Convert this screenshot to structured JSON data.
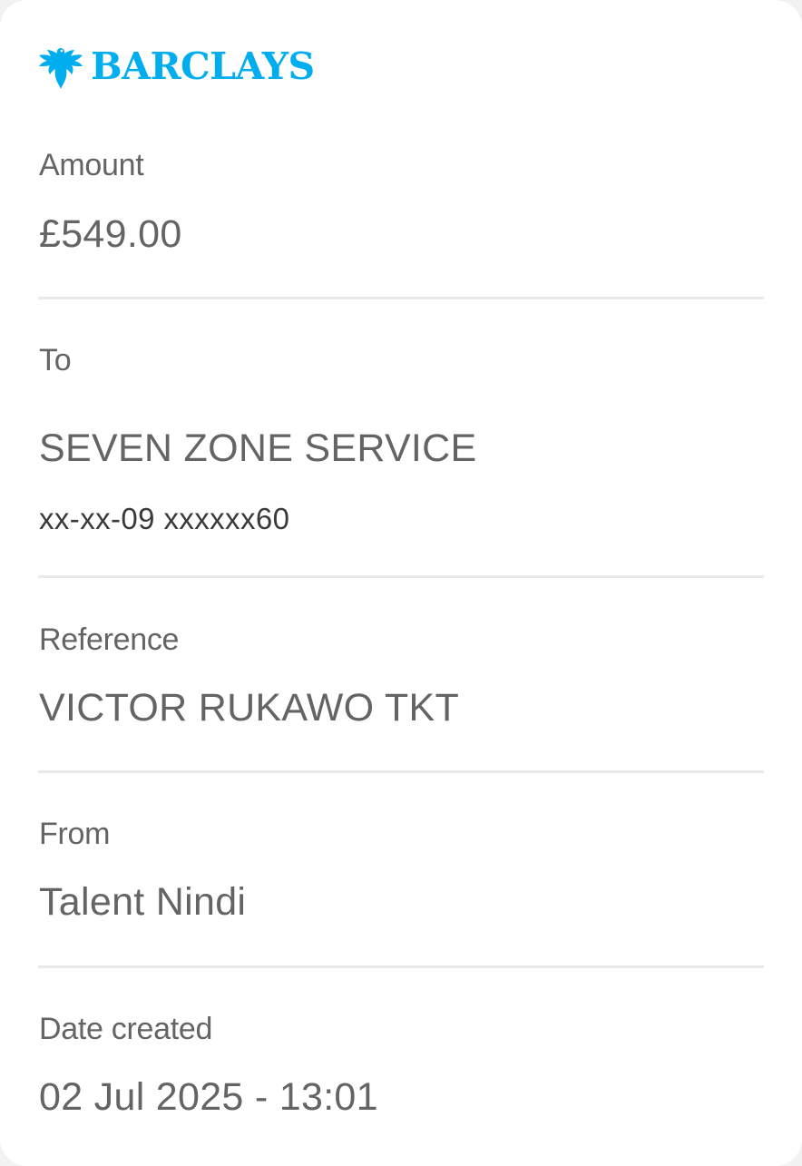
{
  "brand": {
    "name": "BARCLAYS",
    "color": "#00aeef",
    "icon": "eagle-icon"
  },
  "details": {
    "amount": {
      "label": "Amount",
      "value": "£549.00"
    },
    "to": {
      "label": "To",
      "name": "SEVEN ZONE SERVICE",
      "account": "xx-xx-09 xxxxxx60"
    },
    "reference": {
      "label": "Reference",
      "value": "VICTOR RUKAWO TKT"
    },
    "from": {
      "label": "From",
      "value": "Talent Nindi"
    },
    "date_created": {
      "label": "Date created",
      "value": "02 Jul 2025 - 13:01"
    }
  }
}
